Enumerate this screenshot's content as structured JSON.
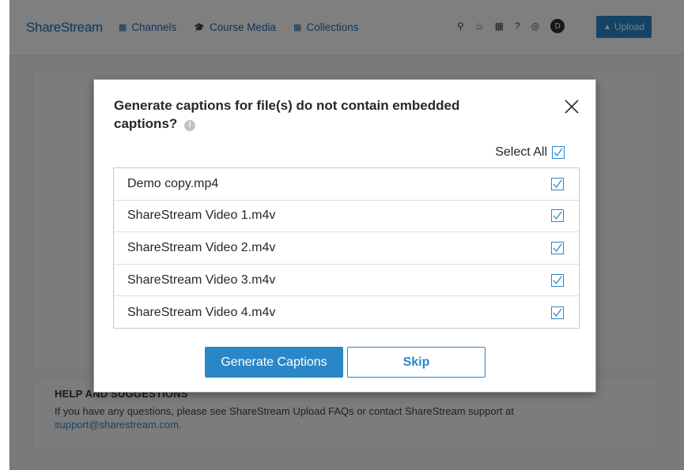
{
  "header": {
    "brand": "ShareStream",
    "nav": [
      {
        "label": "Channels",
        "icon": "channels-icon"
      },
      {
        "label": "Course Media",
        "icon": "graduation-cap-icon"
      },
      {
        "label": "Collections",
        "icon": "collections-icon"
      }
    ],
    "avatar_initial": "D",
    "upload_label": "Upload"
  },
  "help": {
    "title": "HELP AND SUGGESTIONS",
    "text": "If you have any questions, please see ShareStream Upload FAQs or contact ShareStream support at",
    "link": "support@sharestream.com."
  },
  "modal": {
    "title": "Generate captions for file(s) do not contain embedded captions?",
    "info_icon": "!",
    "select_all_label": "Select All",
    "files": [
      {
        "name": "Demo copy.mp4",
        "checked": true
      },
      {
        "name": "ShareStream Video 1.m4v",
        "checked": true
      },
      {
        "name": "ShareStream Video 2.m4v",
        "checked": true
      },
      {
        "name": "ShareStream Video 3.m4v",
        "checked": true
      },
      {
        "name": "ShareStream Video 4.m4v",
        "checked": true
      }
    ],
    "generate_label": "Generate Captions",
    "skip_label": "Skip"
  },
  "colors": {
    "accent": "#2a87c7",
    "brand": "#1e6fb0",
    "overlay": "rgba(0,0,0,0.5)"
  }
}
